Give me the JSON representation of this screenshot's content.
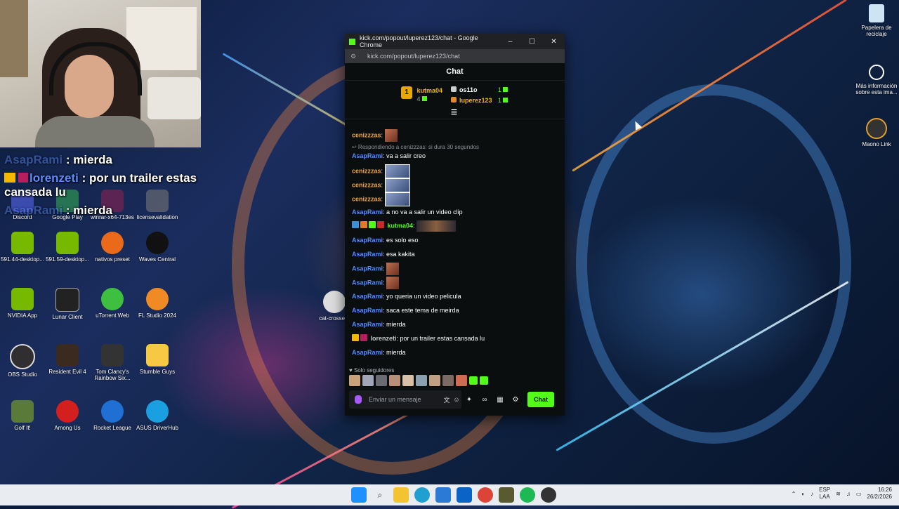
{
  "overlay": {
    "lines": [
      {
        "user": "AsapRami",
        "text": " : mierda"
      },
      {
        "user": "lorenzeti",
        "text": " : por un trailer estas cansada lu"
      },
      {
        "user": "AsapRami",
        "text": " : mierda"
      }
    ]
  },
  "desktop_icons": [
    {
      "label": "Discord"
    },
    {
      "label": "Google Play"
    },
    {
      "label": "winrar-x64-713es"
    },
    {
      "label": "licensevalidation"
    },
    {
      "label": "591.44-desktop..."
    },
    {
      "label": "591.59-desktop..."
    },
    {
      "label": "nativos preset"
    },
    {
      "label": "Waves Central"
    },
    {
      "label": "NVIDIA App"
    },
    {
      "label": "Lunar Client"
    },
    {
      "label": "uTorrent Web"
    },
    {
      "label": "FL Studio 2024"
    },
    {
      "label": "OBS Studio"
    },
    {
      "label": "Resident Evil 4"
    },
    {
      "label": "Tom Clancy's Rainbow Six..."
    },
    {
      "label": "Stumble Guys"
    },
    {
      "label": "Golf It!"
    },
    {
      "label": "Among Us"
    },
    {
      "label": "Rocket League"
    },
    {
      "label": "ASUS DriverHub"
    },
    {
      "label": "cat-crosse..."
    }
  ],
  "right_icons": [
    {
      "label": "Papelera de reciclaje"
    },
    {
      "label": "Más información sobre esta ima..."
    },
    {
      "label": "Maono Link"
    }
  ],
  "browser": {
    "title": "kick.com/popout/luperez123/chat - Google Chrome",
    "url": "kick.com/popout/luperez123/chat",
    "controls": {
      "minimize": "–",
      "maximize": "☐",
      "close": "✕"
    }
  },
  "chat": {
    "header": "Chat",
    "leaderboard": {
      "first": {
        "rank": "1",
        "name": "kutma04",
        "count": "4"
      },
      "second": {
        "name": "os11o",
        "count": "1"
      },
      "third": {
        "name": "luperez123",
        "count": "1"
      }
    },
    "reply_note": "↩ Respondiendo a cenizzzas: si dura 30 segundos",
    "messages": [
      {
        "user": "cenizzzas",
        "text": ":"
      },
      {
        "user": "AsapRami",
        "text": ": va a salir creo"
      },
      {
        "user": "cenizzzas",
        "text": ":"
      },
      {
        "user": "cenizzzas",
        "text": ":"
      },
      {
        "user": "cenizzzas",
        "text": ":"
      },
      {
        "user": "AsapRami",
        "text": ": a no va a salir un video clip"
      },
      {
        "user": "kutma04",
        "text": ":"
      },
      {
        "user": "AsapRami",
        "text": ": es solo eso"
      },
      {
        "user": "AsapRami",
        "text": ": esa kakita"
      },
      {
        "user": "AsapRami",
        "text": ":"
      },
      {
        "user": "AsapRami",
        "text": ":"
      },
      {
        "user": "AsapRami",
        "text": ": yo queria un video pelicula"
      },
      {
        "user": "AsapRami",
        "text": ": saca este tema de meirda"
      },
      {
        "user": "AsapRami",
        "text": ": mierda"
      },
      {
        "user": "lorenzeti",
        "text": ": por un trailer estas cansada lu"
      },
      {
        "user": "AsapRami",
        "text": ": mierda"
      }
    ],
    "followers_only": "♥ Solo seguidores",
    "input_placeholder": "Enviar un mensaje",
    "send_button": "Chat"
  },
  "taskbar": {
    "lang_top": "ESP",
    "lang_bottom": "LAA",
    "time": "16:26",
    "date": "26/2/2026"
  },
  "colors": {
    "kick_green": "#53fc18",
    "username_blue": "#4f8dff",
    "username_orange": "#f0a53c"
  }
}
